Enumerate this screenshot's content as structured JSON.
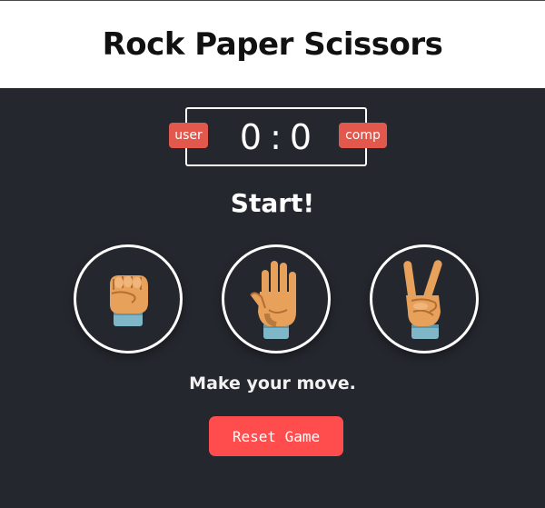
{
  "header": {
    "title": "Rock Paper Scissors"
  },
  "score": {
    "user": "0",
    "separator": ":",
    "comp": "0",
    "user_label": "user",
    "comp_label": "comp"
  },
  "result": {
    "text": "Start!"
  },
  "choices": [
    {
      "icon": "rock-fist-icon"
    },
    {
      "icon": "paper-hand-icon"
    },
    {
      "icon": "scissors-hand-icon"
    }
  ],
  "message": {
    "text": "Make your move."
  },
  "reset": {
    "label": "Reset Game"
  },
  "colors": {
    "background": "#24272e",
    "header_bg": "#ffffff",
    "badge": "#e2584d",
    "button": "#ff4d4d",
    "skin": "#e8a15a",
    "cuff": "#7fb7c9"
  }
}
